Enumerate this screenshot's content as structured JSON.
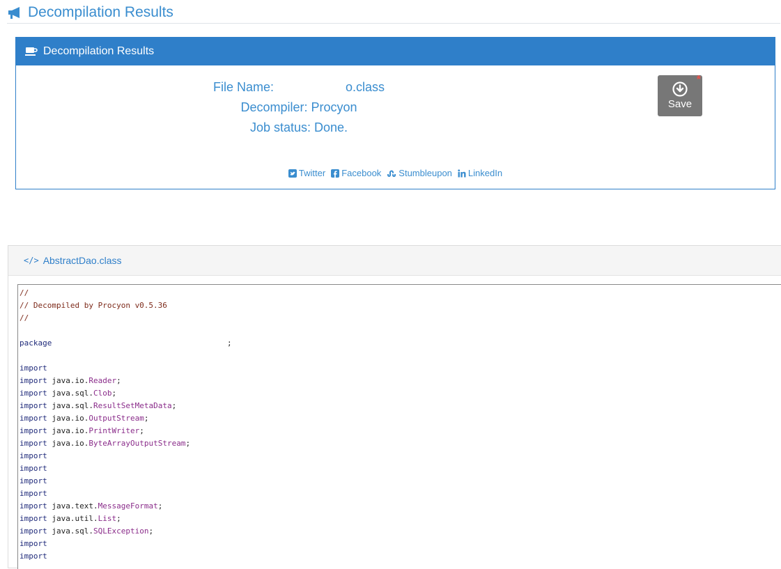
{
  "page_title": "Decompilation Results",
  "panel": {
    "title": "Decompilation Results",
    "file_name_label": "File Name:",
    "file_name_suffix": "o.class",
    "decompiler": "Decompiler: Procyon",
    "job_status": "Job status: Done.",
    "save_label": "Save",
    "share": {
      "twitter": "Twitter",
      "facebook": "Facebook",
      "stumbleupon": "Stumbleupon",
      "linkedin": "LinkedIn"
    }
  },
  "code": {
    "file_tab": "AbstractDao.class",
    "lines": [
      {
        "kind": "comment",
        "text": "//"
      },
      {
        "kind": "comment",
        "text": "// Decompiled by Procyon v0.5.36"
      },
      {
        "kind": "comment",
        "text": "//"
      },
      {
        "kind": "blank",
        "text": ""
      },
      {
        "kind": "package",
        "kw": "package",
        "pkg": "",
        "cls": "",
        "end": ";"
      },
      {
        "kind": "blank",
        "text": ""
      },
      {
        "kind": "import",
        "kw": "import",
        "pkg": "",
        "cls": "",
        "end": ""
      },
      {
        "kind": "import",
        "kw": "import",
        "pkg": "java.io.",
        "cls": "Reader",
        "end": ";"
      },
      {
        "kind": "import",
        "kw": "import",
        "pkg": "java.sql.",
        "cls": "Clob",
        "end": ";"
      },
      {
        "kind": "import",
        "kw": "import",
        "pkg": "java.sql.",
        "cls": "ResultSetMetaData",
        "end": ";"
      },
      {
        "kind": "import",
        "kw": "import",
        "pkg": "java.io.",
        "cls": "OutputStream",
        "end": ";"
      },
      {
        "kind": "import",
        "kw": "import",
        "pkg": "java.io.",
        "cls": "PrintWriter",
        "end": ";"
      },
      {
        "kind": "import",
        "kw": "import",
        "pkg": "java.io.",
        "cls": "ByteArrayOutputStream",
        "end": ";"
      },
      {
        "kind": "import",
        "kw": "import",
        "pkg": "",
        "cls": "",
        "end": ""
      },
      {
        "kind": "import",
        "kw": "import",
        "pkg": "",
        "cls": "",
        "end": ""
      },
      {
        "kind": "import",
        "kw": "import",
        "pkg": "",
        "cls": "",
        "end": ""
      },
      {
        "kind": "import",
        "kw": "import",
        "pkg": "",
        "cls": "",
        "end": ""
      },
      {
        "kind": "import",
        "kw": "import",
        "pkg": "java.text.",
        "cls": "MessageFormat",
        "end": ";"
      },
      {
        "kind": "import",
        "kw": "import",
        "pkg": "java.util.",
        "cls": "List",
        "end": ";"
      },
      {
        "kind": "import",
        "kw": "import",
        "pkg": "java.sql.",
        "cls": "SQLException",
        "end": ";"
      },
      {
        "kind": "import",
        "kw": "import",
        "pkg": "",
        "cls": "",
        "end": ""
      },
      {
        "kind": "import",
        "kw": "import",
        "pkg": "",
        "cls": "",
        "end": ""
      }
    ]
  },
  "colors": {
    "accent": "#2f7fc9",
    "link": "#3a8dcf",
    "save_button": "#777777",
    "comment": "#7d2a1a",
    "keyword": "#1f2a7a",
    "class_name": "#8a2c8a"
  },
  "icons": {
    "page_title": "megaphone-icon",
    "panel_header": "coffee-cup-icon",
    "save": "download-circle-icon",
    "code_tab": "code-icon"
  }
}
